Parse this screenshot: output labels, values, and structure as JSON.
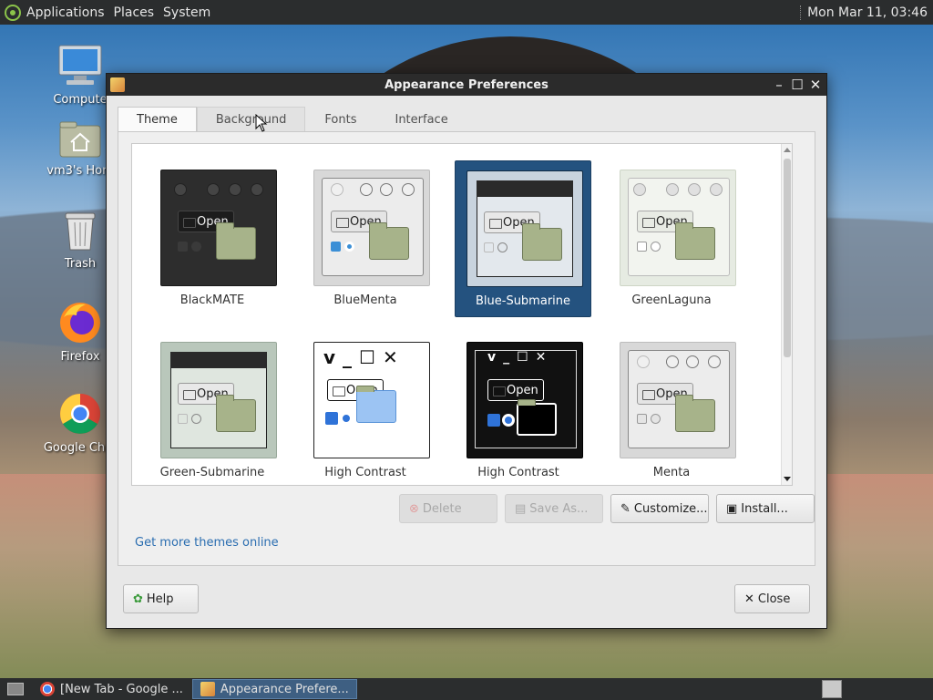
{
  "top_panel": {
    "menus": [
      "Applications",
      "Places",
      "System"
    ],
    "clock": "Mon Mar 11, 03:46"
  },
  "desktop_icons": [
    {
      "label": "Compute",
      "icon": "computer-icon"
    },
    {
      "label": "vm3's Hom",
      "icon": "home-folder-icon"
    },
    {
      "label": "Trash",
      "icon": "trash-icon"
    },
    {
      "label": "Firefox",
      "icon": "firefox-icon"
    },
    {
      "label": "Google Chro",
      "icon": "chrome-icon"
    }
  ],
  "window": {
    "title": "Appearance Preferences",
    "tabs": [
      "Theme",
      "Background",
      "Fonts",
      "Interface"
    ],
    "active_tab": "Theme",
    "themes": [
      {
        "name": "BlackMATE",
        "selected": false
      },
      {
        "name": "BlueMenta",
        "selected": false
      },
      {
        "name": "Blue-Submarine",
        "selected": true
      },
      {
        "name": "GreenLaguna",
        "selected": false
      },
      {
        "name": "Green-Submarine",
        "selected": false
      },
      {
        "name": "High Contrast",
        "selected": false
      },
      {
        "name": "High Contrast",
        "selected": false
      },
      {
        "name": "Menta",
        "selected": false
      }
    ],
    "thumb_open_label": "Open",
    "actions": {
      "delete": "Delete",
      "save_as": "Save As...",
      "customize": "Customize...",
      "install": "Install..."
    },
    "more_link": "Get more themes online",
    "help": "Help",
    "close": "Close",
    "selection_color": "#24527f"
  },
  "taskbar": {
    "tasks": [
      "[New Tab - Google ...",
      "Appearance Prefere..."
    ]
  }
}
